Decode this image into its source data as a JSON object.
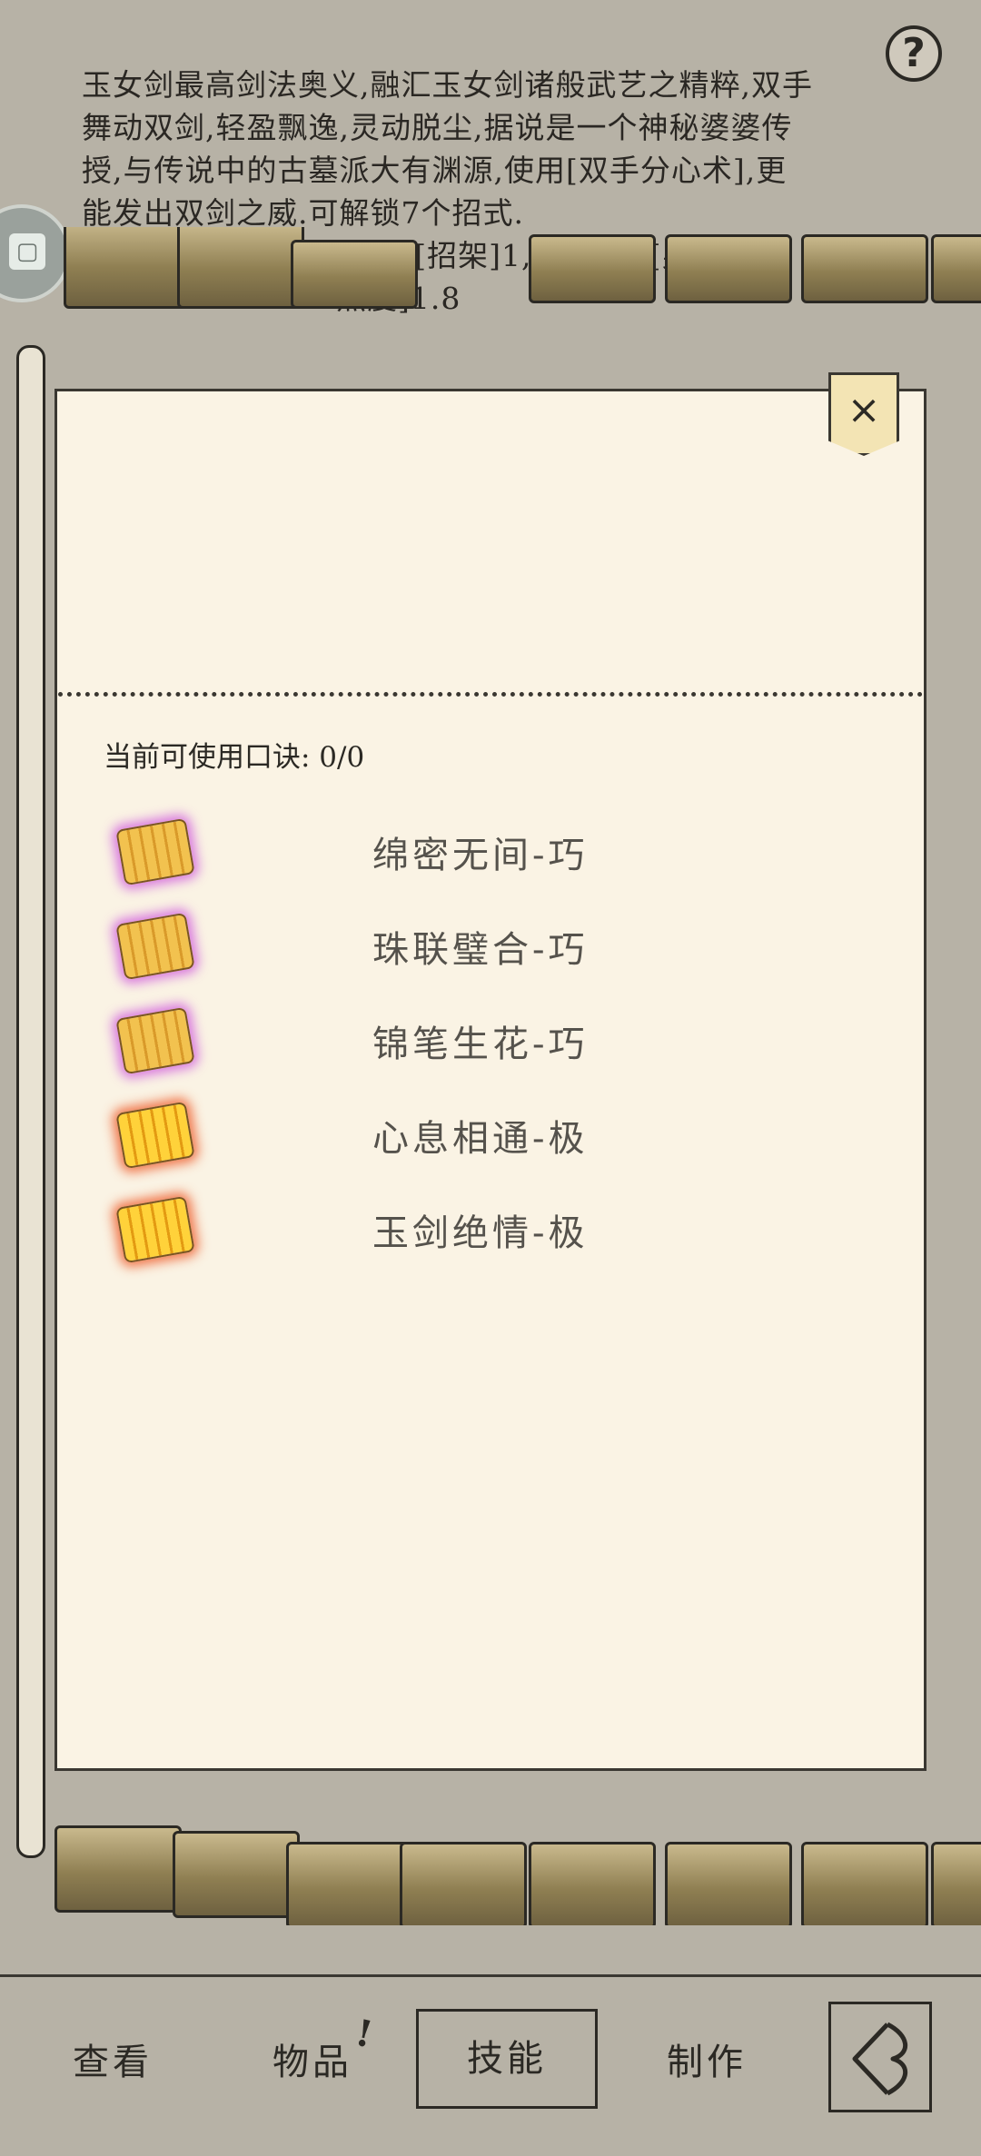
{
  "background": {
    "description_lines": [
      "玉女剑最高剑法奥义,融汇玉女剑诸般武艺之精粹,双手",
      "舞动双剑,轻盈飘逸,灵动脱尘,据说是一个神秘婆婆传",
      "授,与传说中的古墓派大有渊源,使用[双手分心术],更",
      "能发出双剑之威.可解锁7个招式.",
      "1.4,[命中]3,[招架]1,[内伤]1,[身法",
      "烈度]1.8"
    ]
  },
  "panel": {
    "close_glyph": "×",
    "current_label": "当前可使用口诀: 0/0",
    "skills": [
      {
        "name": "绵密无间-巧",
        "rarity": "purple"
      },
      {
        "name": "珠联璧合-巧",
        "rarity": "purple"
      },
      {
        "name": "锦笔生花-巧",
        "rarity": "purple"
      },
      {
        "name": "心息相通-极",
        "rarity": "orange"
      },
      {
        "name": "玉剑绝情-极",
        "rarity": "orange"
      }
    ]
  },
  "nav": {
    "view": "查看",
    "items": "物品",
    "items_alert": "!",
    "skills": "技能",
    "craft": "制作"
  },
  "help": "?",
  "colors": {
    "paper": "#faf3e4",
    "background": "#b7b2a6",
    "purple_glow": "#cd50dc",
    "orange_glow": "#ee5a28"
  }
}
